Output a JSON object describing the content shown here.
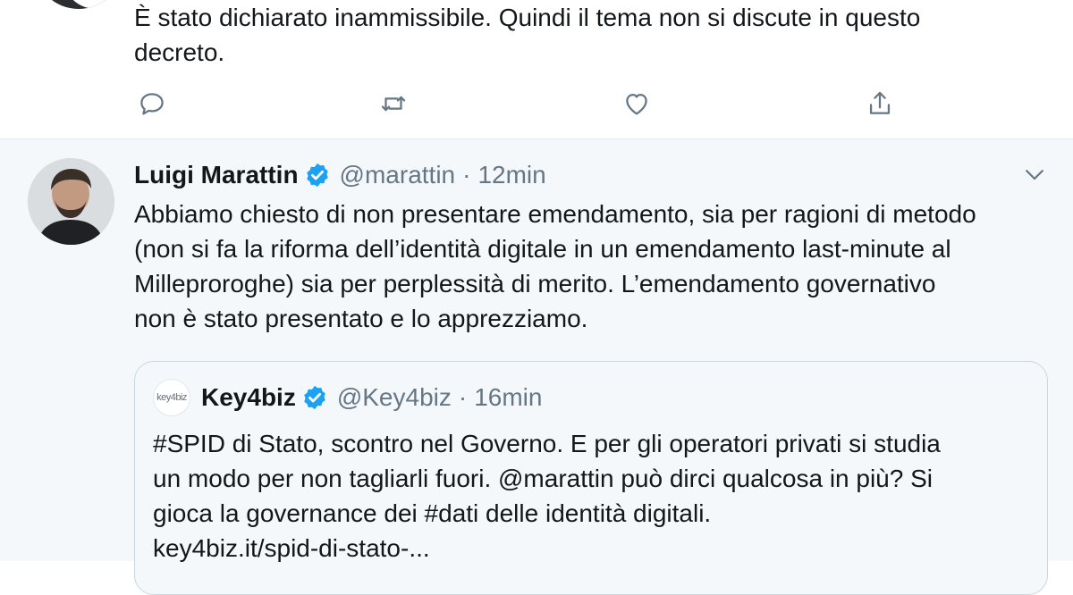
{
  "previous_tweet": {
    "text_line1": "È stato dichiarato inammissibile. Quindi il tema non si discute in questo",
    "text_line2": "decreto.",
    "actions": {
      "reply_icon": "reply-icon",
      "retweet_icon": "retweet-icon",
      "like_icon": "heart-icon",
      "share_icon": "share-icon"
    }
  },
  "tweet": {
    "name": "Luigi Marattin",
    "handle": "@marattin",
    "separator": "·",
    "time": "12min",
    "lines": [
      "Abbiamo chiesto di non presentare emendamento, sia per ragioni di metodo",
      "(non si fa la riforma dell’identità digitale in un emendamento last-minute al",
      "Milleproroghe) sia per perplessità di merito. L’emendamento governativo",
      "non è stato presentato e lo apprezziamo."
    ]
  },
  "quoted": {
    "logo_text": "key4biz",
    "name": "Key4biz",
    "handle": "@Key4biz",
    "separator": "·",
    "time": "16min",
    "lines": [
      "#SPID di Stato, scontro nel Governo. E per gli operatori privati si studia",
      "un modo per non tagliarli fuori. @marattin può dirci qualcosa in più? Si",
      "gioca la governance dei #dati delle identità digitali."
    ],
    "link": "key4biz.it/spid-di-stato-..."
  },
  "colors": {
    "verified": "#1da1f2",
    "secondary_text": "#657786",
    "icon": "#657786",
    "highlight_bg": "#f5f8fa"
  }
}
